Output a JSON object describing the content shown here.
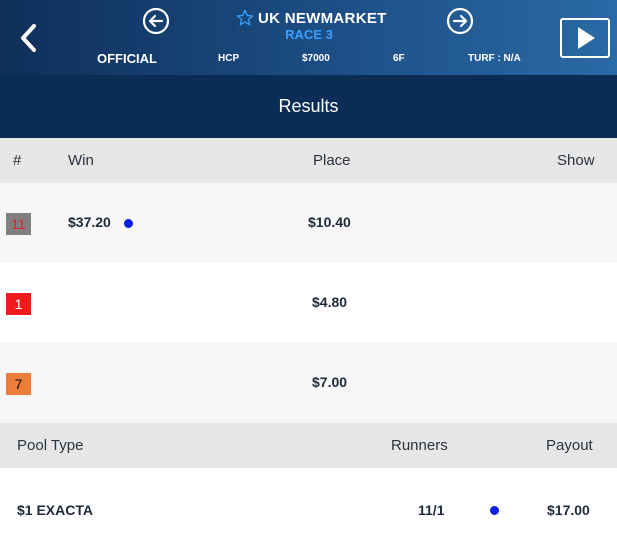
{
  "header": {
    "track": "UK NEWMARKET",
    "race": "RACE 3",
    "status": "OFFICIAL",
    "race_type": "HCP",
    "purse": "$7000",
    "distance": "6F",
    "surface": "TURF : N/A"
  },
  "results": {
    "title": "Results",
    "columns": {
      "num": "#",
      "win": "Win",
      "place": "Place",
      "show": "Show"
    },
    "rows": [
      {
        "num": "11",
        "win": "$37.20",
        "place": "$10.40",
        "show": "",
        "num_bg": "#808080",
        "num_color": "#e02020"
      },
      {
        "num": "1",
        "win": "",
        "place": "$4.80",
        "show": "",
        "num_bg": "#ee1c1c",
        "num_color": "#ffffff"
      },
      {
        "num": "7",
        "win": "",
        "place": "$7.00",
        "show": "",
        "num_bg": "#ef7d3a",
        "num_color": "#111111"
      }
    ]
  },
  "pools": {
    "columns": {
      "pool_type": "Pool Type",
      "runners": "Runners",
      "payout": "Payout"
    },
    "rows": [
      {
        "pool_type": "$1 EXACTA",
        "runners": "11/1",
        "payout": "$17.00"
      }
    ]
  },
  "colors": {
    "header_dark": "#0f2f5a",
    "results_bar": "#0b2c55",
    "race_accent": "#3aa0ff",
    "dot": "#0a1fe0"
  },
  "icons": {
    "back": "chevron-left-icon",
    "prev": "arrow-left-circle-icon",
    "next": "arrow-right-circle-icon",
    "favorite": "star-outline-icon",
    "video": "play-icon"
  }
}
